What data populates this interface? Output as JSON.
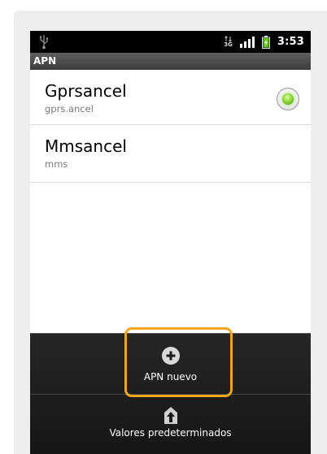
{
  "statusbar": {
    "network_label": "3G",
    "time": "3:53"
  },
  "titlebar": {
    "title": "APN"
  },
  "apn_list": [
    {
      "name": "Gprsancel",
      "apn": "gprs.ancel",
      "selected": true
    },
    {
      "name": "Mmsancel",
      "apn": "mms",
      "selected": false
    }
  ],
  "menu": {
    "new_apn_label": "APN nuevo",
    "reset_label": "Valores predeterminados"
  },
  "colors": {
    "highlight": "#f5a61b",
    "radio_selected": "#7ed321",
    "titlebar": "#4a4a4a"
  },
  "icons": {
    "usb": "usb-icon",
    "network": "network-3g-icon",
    "signal": "signal-icon",
    "battery": "battery-icon",
    "add": "add-icon",
    "reset": "reset-icon"
  }
}
